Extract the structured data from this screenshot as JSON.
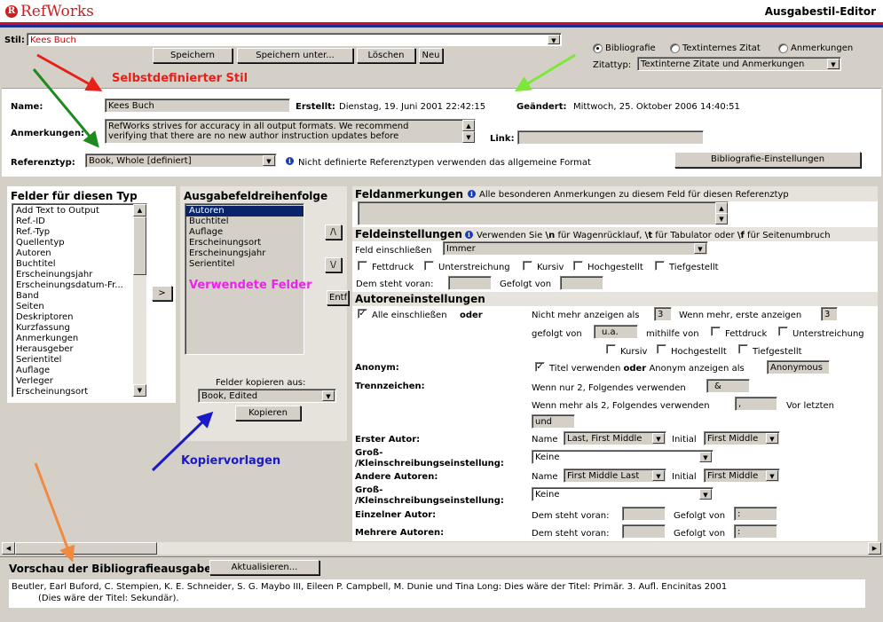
{
  "app": {
    "logo_text": "RefWorks",
    "window_title": "Ausgabestil-Editor"
  },
  "style_row": {
    "label": "Stil:",
    "selected": "Kees Buch",
    "buttons": {
      "save": "Speichern",
      "save_as": "Speichern unter...",
      "delete": "Löschen",
      "new": "Neu"
    },
    "modes": {
      "bibliography": "Bibliografie",
      "intext": "Textinternes Zitat",
      "notes": "Anmerkungen"
    },
    "zitattyp_label": "Zitattyp:",
    "zitattyp_value": "Textinterne Zitate und Anmerkungen"
  },
  "annotations": {
    "custom_style": "Selbstdefinierter Stil",
    "used_fields": "Verwendete Felder",
    "copy_templates": "Kopiervorlagen"
  },
  "meta": {
    "name_label": "Name:",
    "name_value": "Kees Buch",
    "created_label": "Erstellt:",
    "created_value": "Dienstag, 19. Juni 2001 22:42:15",
    "changed_label": "Geändert:",
    "changed_value": "Mittwoch, 25. Oktober 2006 14:40:51",
    "notes_label": "Anmerkungen:",
    "notes_line1": "RefWorks strives for accuracy in all output formats. We recommend",
    "notes_line2": "verifying that there are no new author instruction updates before",
    "link_label": "Link:",
    "reftype_label": "Referenztyp:",
    "reftype_value": "Book, Whole [definiert]",
    "reftype_info": "Nicht definierte Referenztypen verwenden das allgemeine Format",
    "bib_settings_button": "Bibliografie-Einstellungen"
  },
  "fields_panel": {
    "title": "Felder für diesen Typ",
    "items": [
      "Add Text to Output",
      "Ref.-ID",
      "Ref.-Typ",
      "Quellentyp",
      "Autoren",
      "Buchtitel",
      "Erscheinungsjahr",
      "Erscheinungsdatum-Fr...",
      "Band",
      "Seiten",
      "Deskriptoren",
      "Kurzfassung",
      "Anmerkungen",
      "Herausgeber",
      "Serientitel",
      "Auflage",
      "Verleger",
      "Erscheinungsort"
    ],
    "add_button": ">"
  },
  "order_panel": {
    "title": "Ausgabefeldreihenfolge",
    "items": [
      "Autoren",
      "Buchtitel",
      "Auflage",
      "Erscheinungsort",
      "Erscheinungsjahr",
      "Serientitel"
    ],
    "up_button": "/\\",
    "down_button": "\\/",
    "remove_button": "Entf",
    "copy_label": "Felder kopieren aus:",
    "copy_from": "Book, Edited",
    "copy_button": "Kopieren"
  },
  "field_notes": {
    "title": "Feldanmerkungen",
    "info": "Alle besonderen Anmerkungen zu diesem Feld für diesen Referenztyp"
  },
  "field_settings": {
    "title": "Feldeinstellungen",
    "info_pre": "Verwenden Sie ",
    "info_n": "\\n",
    "info_mid1": " für Wagenrücklauf, ",
    "info_t": "\\t",
    "info_mid2": " für Tabulator oder ",
    "info_f": "\\f",
    "info_post": " für Seitenumbruch",
    "include_label": "Feld einschließen",
    "include_value": "Immer",
    "bold": "Fettdruck",
    "underline": "Unterstreichung",
    "italic": "Kursiv",
    "superscript": "Hochgestellt",
    "subscript": "Tiefgestellt",
    "preceded_label": "Dem steht voran:",
    "followed_label": "Gefolgt von"
  },
  "author_settings": {
    "title": "Autoreneinstellungen",
    "include_all": "Alle einschließen",
    "or": "oder",
    "show_max_label": "Nicht mehr anzeigen als",
    "show_max_value": "3",
    "if_more_label": "Wenn mehr, erste anzeigen",
    "if_more_value": "3",
    "followed_by_label": "gefolgt von",
    "followed_by_value": "u.a.",
    "using_label": "mithilfe von",
    "bold": "Fettdruck",
    "underline": "Unterstreichung",
    "italic": "Kursiv",
    "superscript": "Hochgestellt",
    "subscript": "Tiefgestellt",
    "anon_label": "Anonym:",
    "anon_use_title": "Titel verwenden",
    "anon_or": "oder",
    "anon_show_as": "Anonym anzeigen als",
    "anon_value": "Anonymous",
    "sep_label": "Trennzeichen:",
    "sep_two_label": "Wenn nur 2, Folgendes verwenden",
    "sep_two_value": "&",
    "sep_more_label": "Wenn mehr als 2, Folgendes verwenden",
    "sep_more_value": ",",
    "before_last_label": "Vor letzten",
    "before_last_value": "und",
    "first_author_label": "Erster Autor:",
    "name_label": "Name",
    "first_name_value": "Last, First Middle",
    "initial_label": "Initial",
    "first_initial_value": "First Middle",
    "case_label_1": "Groß-",
    "case_label_2": "/Kleinschreibungseinstellung:",
    "case_value": "Keine",
    "other_authors_label": "Andere Autoren:",
    "other_name_value": "First Middle Last",
    "other_initial_value": "First Middle",
    "single_author_label": "Einzelner Autor:",
    "multi_author_label": "Mehrere Autoren:",
    "preceded_label": "Dem steht voran:",
    "followed_label": "Gefolgt von",
    "single_followed_value": ":",
    "multi_followed_value": ":"
  },
  "preview": {
    "title": "Vorschau der Bibliografieausgabe",
    "refresh_button": "Aktualisieren...",
    "line1": "Beutler, Earl Buford, C. Stempien, K. E. Schneider, S. G. Maybo III, Eileen P. Campbell, M. Dunie und Tina Long: Dies wäre der Titel: Primär. 3. Aufl. Encinitas 2001",
    "line2": "(Dies wäre der Titel: Sekundär)."
  },
  "colors": {
    "logo_red": "#cc1f1f",
    "stripe_red": "#c8102e",
    "stripe_blue": "#1c2f8c",
    "annotation_red": "#e8201a",
    "annotation_magenta": "#ee22ee",
    "annotation_blue": "#1a1ac8"
  }
}
